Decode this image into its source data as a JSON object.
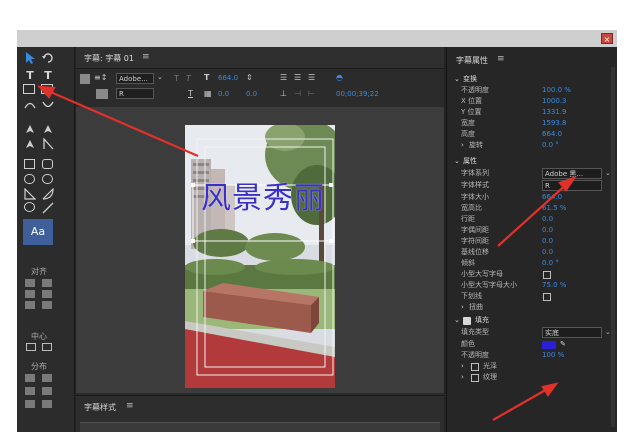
{
  "window": {
    "close_glyph": "×"
  },
  "tools": {
    "align_label": "对齐",
    "center_label": "中心",
    "distribute_label": "分布",
    "text_tool_glyph": "T",
    "style_swatch": "Aa"
  },
  "main_panel": {
    "title": "字幕: 字幕 01",
    "menu_glyph": "≡",
    "font_family": "Adobe...",
    "font_style": "R",
    "font_size": "664.0",
    "kerning": "0.0",
    "leading": "0.0",
    "timecode": "00;00;39;22",
    "subtitle_text": "风景秀丽"
  },
  "styles_panel": {
    "title": "字幕样式",
    "menu_glyph": "≡"
  },
  "properties": {
    "title": "字幕属性",
    "menu_glyph": "≡",
    "transform_section": "变换",
    "opacity_label": "不透明度",
    "opacity_value": "100.0 %",
    "x_label": "X 位置",
    "x_value": "1000.3",
    "y_label": "Y 位置",
    "y_value": "1331.9",
    "width_label": "宽度",
    "width_value": "1593.8",
    "height_label": "高度",
    "height_value": "664.0",
    "rotation_label": "旋转",
    "rotation_value": "0.0 °",
    "props_section": "属性",
    "font_family_label": "字体系列",
    "font_family_value": "Adobe 黑...",
    "font_style_label": "字体样式",
    "font_style_value": "R",
    "font_size_label": "字体大小",
    "font_size_value": "664.0",
    "aspect_label": "宽高比",
    "aspect_value": "61.5 %",
    "leading_label": "行距",
    "leading_value": "0.0",
    "kerning_label": "字偶间距",
    "kerning_value": "0.0",
    "tracking_label": "字符间距",
    "tracking_value": "0.0",
    "baseline_label": "基线位移",
    "baseline_value": "0.0",
    "slant_label": "倾斜",
    "slant_value": "0.0 °",
    "smallcaps_label": "小型大写字母",
    "smallcaps_size_label": "小型大写字母大小",
    "smallcaps_size_value": "75.0 %",
    "underline_label": "下划线",
    "distort_label": "扭曲",
    "fill_section": "填充",
    "fill_type_label": "填充类型",
    "fill_type_value": "实底",
    "color_label": "颜色",
    "fill_color": "#2a1fd6",
    "fill_opacity_label": "不透明度",
    "fill_opacity_value": "100 %",
    "sheen_label": "光泽",
    "texture_label": "纹理"
  },
  "colors": {
    "accent_blue": "#3a8be0",
    "arrow_red": "#e0312b",
    "subtitle_blue": "#3a30c8"
  }
}
